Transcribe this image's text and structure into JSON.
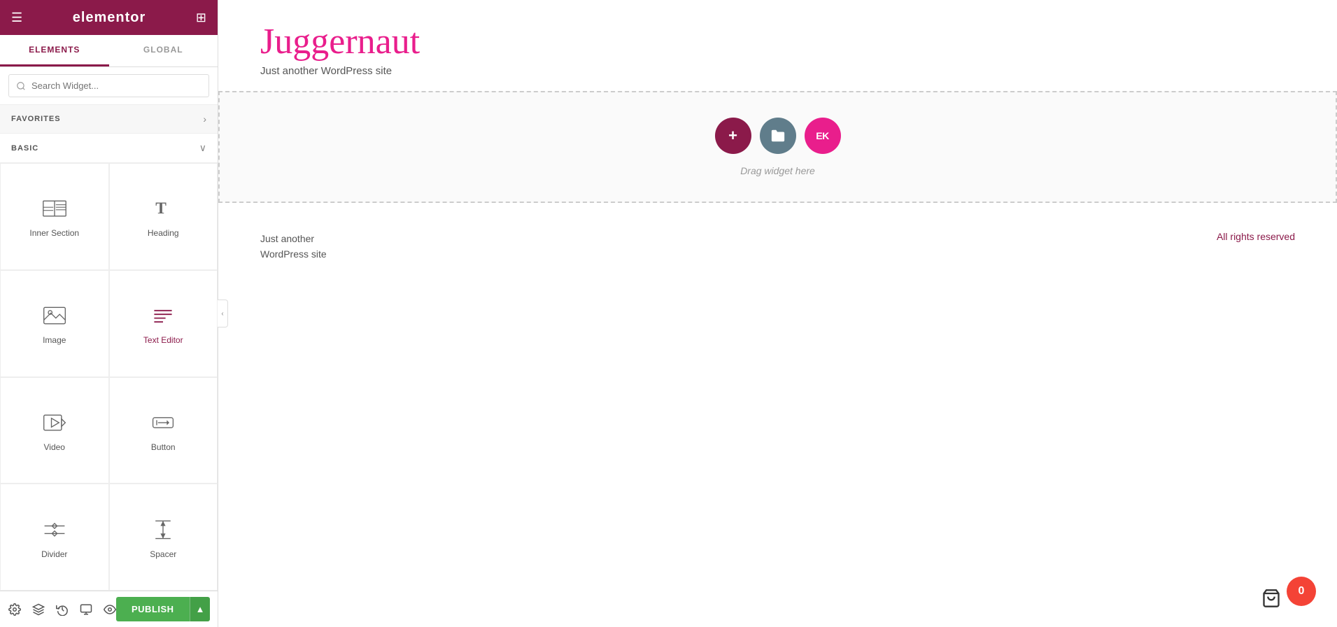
{
  "header": {
    "logo": "elementor",
    "menu_icon": "☰",
    "grid_icon": "⊞"
  },
  "tabs": [
    {
      "id": "elements",
      "label": "ELEMENTS",
      "active": true
    },
    {
      "id": "global",
      "label": "GLOBAL",
      "active": false
    }
  ],
  "search": {
    "placeholder": "Search Widget...",
    "value": ""
  },
  "favorites": {
    "label": "FAVORITES",
    "arrow": "›"
  },
  "basic": {
    "label": "BASIC",
    "arrow": "∨"
  },
  "widgets": [
    {
      "id": "inner-section",
      "label": "Inner Section",
      "icon": "inner-section-icon"
    },
    {
      "id": "heading",
      "label": "Heading",
      "icon": "heading-icon"
    },
    {
      "id": "image",
      "label": "Image",
      "icon": "image-icon"
    },
    {
      "id": "text-editor",
      "label": "Text Editor",
      "icon": "text-editor-icon",
      "highlight": true
    },
    {
      "id": "video",
      "label": "Video",
      "icon": "video-icon"
    },
    {
      "id": "button",
      "label": "Button",
      "icon": "button-icon"
    },
    {
      "id": "divider",
      "label": "Divider",
      "icon": "divider-icon"
    },
    {
      "id": "spacer",
      "label": "Spacer",
      "icon": "spacer-icon"
    }
  ],
  "footer_icons": [
    "settings-icon",
    "layers-icon",
    "history-icon",
    "responsive-icon",
    "preview-icon"
  ],
  "publish_button": {
    "label": "PUBLISH",
    "dropdown": "▲"
  },
  "canvas": {
    "site_title": "Juggernaut",
    "site_tagline": "Just another WordPress site",
    "drop_zone_text": "Drag widget here",
    "footer_left": "Just another\nWordPress site",
    "footer_right": "All rights reserved",
    "cart_count": "0"
  }
}
